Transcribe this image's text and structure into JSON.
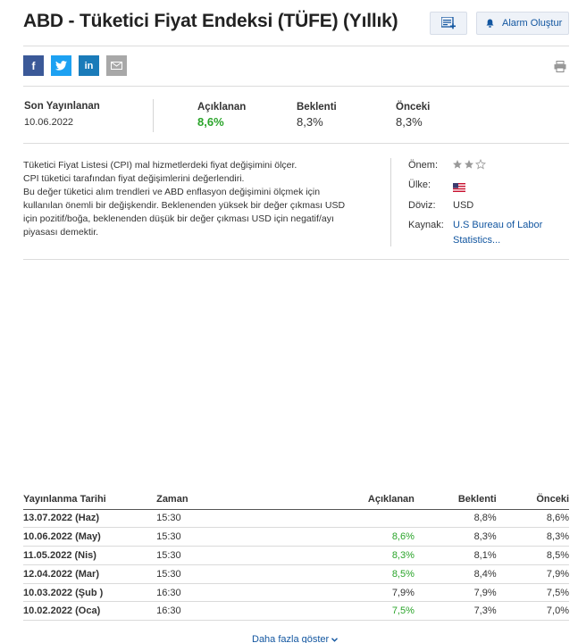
{
  "header": {
    "title": "ABD - Tüketici Fiyat Endeksi (TÜFE) (Yıllık)",
    "portfolio_icon": "add-to-list-icon",
    "alarm_label": "Alarm Oluştur",
    "alarm_icon": "bell-icon"
  },
  "social": {
    "facebook": "f",
    "twitter": "twitter-bird-icon",
    "linkedin": "in",
    "email": "envelope-icon",
    "print": "printer-icon"
  },
  "summary": {
    "last_release_label": "Son Yayınlanan",
    "last_release_value": "10.06.2022",
    "actual_label": "Açıklanan",
    "actual_value": "8,6%",
    "forecast_label": "Beklenti",
    "forecast_value": "8,3%",
    "previous_label": "Önceki",
    "previous_value": "8,3%"
  },
  "description": {
    "lines": [
      "Tüketici Fiyat Listesi (CPI) mal hizmetlerdeki fiyat değişimini ölçer.",
      "CPI tüketici tarafından fiyat değişimlerini değerlendiri.",
      "Bu değer tüketici alım trendleri ve ABD enflasyon değişimini ölçmek için kullanılan önemli bir değişkendir. Beklenenden yüksek bir değer çıkması USD için pozitif/boğa, beklenenden düşük bir değer çıkması USD için negatif/ayı piyasası demektir."
    ]
  },
  "meta": {
    "importance_label": "Önem:",
    "importance_stars_filled": 2,
    "importance_stars_total": 3,
    "country_label": "Ülke:",
    "country_flag": "us-flag-icon",
    "currency_label": "Döviz:",
    "currency_value": "USD",
    "source_label": "Kaynak:",
    "source_line1": "U.S Bureau of Labor",
    "source_line2": "Statistics..."
  },
  "history": {
    "headers": [
      "Yayınlanma Tarihi",
      "Zaman",
      "Açıklanan",
      "Beklenti",
      "Önceki"
    ],
    "rows": [
      {
        "date": "13.07.2022 (Haz)",
        "time": "15:30",
        "actual": "",
        "forecast": "8,8%",
        "previous": "8,6%",
        "actual_color": "#333333"
      },
      {
        "date": "10.06.2022 (May)",
        "time": "15:30",
        "actual": "8,6%",
        "forecast": "8,3%",
        "previous": "8,3%",
        "actual_color": "#2aa42a"
      },
      {
        "date": "11.05.2022 (Nis)",
        "time": "15:30",
        "actual": "8,3%",
        "forecast": "8,1%",
        "previous": "8,5%",
        "actual_color": "#2aa42a"
      },
      {
        "date": "12.04.2022 (Mar)",
        "time": "15:30",
        "actual": "8,5%",
        "forecast": "8,4%",
        "previous": "7,9%",
        "actual_color": "#2aa42a"
      },
      {
        "date": "10.03.2022 (Şub )",
        "time": "16:30",
        "actual": "7,9%",
        "forecast": "7,9%",
        "previous": "7,5%",
        "actual_color": "#333333"
      },
      {
        "date": "10.02.2022 (Oca)",
        "time": "16:30",
        "actual": "7,5%",
        "forecast": "7,3%",
        "previous": "7,0%",
        "actual_color": "#2aa42a"
      }
    ],
    "more_label": "Daha fazla göster"
  }
}
